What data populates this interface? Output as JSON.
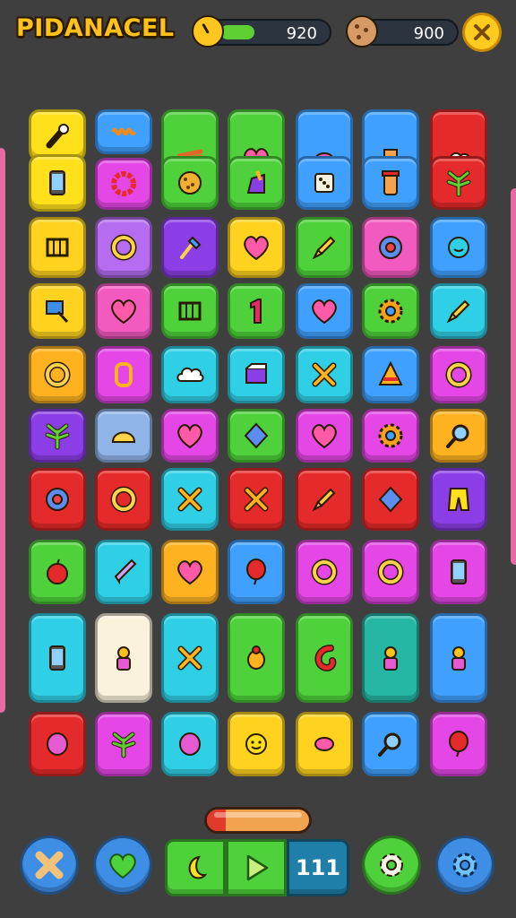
{
  "header": {
    "logo_text": "PIDANACEL",
    "timer_value": "920",
    "timer_progress_fraction": 0.27,
    "coins_value": "900",
    "timer_icon": "stopwatch-icon",
    "coins_icon": "cookie-icon",
    "close_icon": "close-icon"
  },
  "colors": {
    "background": "#3f3f3f",
    "accent_yellow": "#ffcb1f",
    "timer_fill": "#5ed034"
  },
  "board": {
    "tiles": [
      {
        "icon": "wrench-icon",
        "color": "#ffe01a"
      },
      {
        "icon": "spring-icon",
        "color": "#3fa0ff"
      },
      {
        "icon": "phone-icon",
        "color": "#ffe01a"
      },
      {
        "icon": "flower-ring-icon",
        "color": "#e447e6"
      },
      {
        "icon": "pencil-bundle-icon",
        "color": "#4ed13a"
      },
      {
        "icon": "cookie-icon",
        "color": "#4ed13a"
      },
      {
        "icon": "heart-icon",
        "color": "#4ed13a"
      },
      {
        "icon": "paint-bag-icon",
        "color": "#4ed13a"
      },
      {
        "icon": "candy-icon",
        "color": "#3fa0ff"
      },
      {
        "icon": "dice-icon",
        "color": "#3fa0ff"
      },
      {
        "icon": "top-hat-icon",
        "color": "#3fa0ff"
      },
      {
        "icon": "jar-icon",
        "color": "#3fa0ff"
      },
      {
        "icon": "cloud-icon",
        "color": "#e42a2a"
      },
      {
        "icon": "leaf-icon",
        "color": "#e42a2a"
      },
      {
        "icon": "abacus-icon",
        "color": "#ffd21f"
      },
      {
        "icon": "ring-icon",
        "color": "#b56cf0"
      },
      {
        "icon": "brush-icon",
        "color": "#8b3ee6"
      },
      {
        "icon": "heart-icon",
        "color": "#ffd21f"
      },
      {
        "icon": "pencil-icon",
        "color": "#4ed13a"
      },
      {
        "icon": "donut-icon",
        "color": "#f25ac0"
      },
      {
        "icon": "smile-icon",
        "color": "#3fa0ff"
      },
      {
        "icon": "sign-icon",
        "color": "#ffd21f"
      },
      {
        "icon": "heart-icon",
        "color": "#f25ac0"
      },
      {
        "icon": "cage-icon",
        "color": "#4ed13a"
      },
      {
        "icon": "number-one-icon",
        "color": "#4ed13a"
      },
      {
        "icon": "heart-icon",
        "color": "#3fa0ff"
      },
      {
        "icon": "gear-icon",
        "color": "#4ed13a"
      },
      {
        "icon": "crayon-icon",
        "color": "#2fd0e6"
      },
      {
        "icon": "ring-icon",
        "color": "#ffb21f"
      },
      {
        "icon": "clip-icon",
        "color": "#e447e6"
      },
      {
        "icon": "cloud-icon",
        "color": "#2fd0e6"
      },
      {
        "icon": "box-icon",
        "color": "#2fd0e6"
      },
      {
        "icon": "crossed-sticks-icon",
        "color": "#2fd0e6"
      },
      {
        "icon": "cone-icon",
        "color": "#3fa0ff"
      },
      {
        "icon": "ring-icon",
        "color": "#e447e6"
      },
      {
        "icon": "feather-icon",
        "color": "#8b3ee6"
      },
      {
        "icon": "bread-icon",
        "color": "#8fb4e8"
      },
      {
        "icon": "heart-icon",
        "color": "#e447e6"
      },
      {
        "icon": "kite-icon",
        "color": "#4ed13a"
      },
      {
        "icon": "heart-icon",
        "color": "#e447e6"
      },
      {
        "icon": "gear-icon",
        "color": "#e447e6"
      },
      {
        "icon": "magnifier-icon",
        "color": "#ffb21f"
      },
      {
        "icon": "donut-icon",
        "color": "#e42a2a"
      },
      {
        "icon": "ring-icon",
        "color": "#e42a2a"
      },
      {
        "icon": "crossed-tools-icon",
        "color": "#2fd0e6"
      },
      {
        "icon": "crossed-tools-icon",
        "color": "#e42a2a"
      },
      {
        "icon": "crayon-icon",
        "color": "#e42a2a"
      },
      {
        "icon": "kite-icon",
        "color": "#e42a2a"
      },
      {
        "icon": "pants-icon",
        "color": "#8b3ee6"
      },
      {
        "icon": "apple-icon",
        "color": "#4ed13a"
      },
      {
        "icon": "bottle-icon",
        "color": "#2fd0e6"
      },
      {
        "icon": "heart-icon",
        "color": "#ffb21f"
      },
      {
        "icon": "balloon-icon",
        "color": "#3fa0ff"
      },
      {
        "icon": "ring-icon",
        "color": "#e447e6"
      },
      {
        "icon": "ring-icon",
        "color": "#e447e6"
      },
      {
        "icon": "phone-icon",
        "color": "#e447e6"
      },
      {
        "icon": "phone-icon",
        "color": "#2fd0e6"
      },
      {
        "icon": "doll-icon",
        "color": "#fbf2dc"
      },
      {
        "icon": "crossed-sticks-icon",
        "color": "#2fd0e6"
      },
      {
        "icon": "bug-icon",
        "color": "#4ed13a"
      },
      {
        "icon": "hook-icon",
        "color": "#4ed13a"
      },
      {
        "icon": "bird-icon",
        "color": "#26b6a4"
      },
      {
        "icon": "robot-icon",
        "color": "#3fa0ff"
      },
      {
        "icon": "egg-icon",
        "color": "#e42a2a"
      },
      {
        "icon": "palm-icon",
        "color": "#e447e6"
      },
      {
        "icon": "ball-icon",
        "color": "#2fd0e6"
      },
      {
        "icon": "sun-face-icon",
        "color": "#ffd21f"
      },
      {
        "icon": "candy-icon",
        "color": "#ffd21f"
      },
      {
        "icon": "spoon-icon",
        "color": "#3fa0ff"
      },
      {
        "icon": "balloon-icon",
        "color": "#e447e6"
      }
    ]
  },
  "footer": {
    "level_progress_fraction": 0.18,
    "buttons": [
      {
        "name": "shuffle-button",
        "icon": "shuffle-icon",
        "color": "#3fa0ff"
      },
      {
        "name": "favorite-button",
        "icon": "heart-icon",
        "color": "#3fa0ff"
      },
      {
        "name": "settings-button",
        "icon": "gear-icon",
        "color": "#4ed13a"
      },
      {
        "name": "options-button",
        "icon": "cog-icon",
        "color": "#3fa0ff"
      }
    ],
    "segment_left_icon": "moon-icon",
    "segment_middle_icon": "play-icon",
    "segment_right_label": "111"
  }
}
